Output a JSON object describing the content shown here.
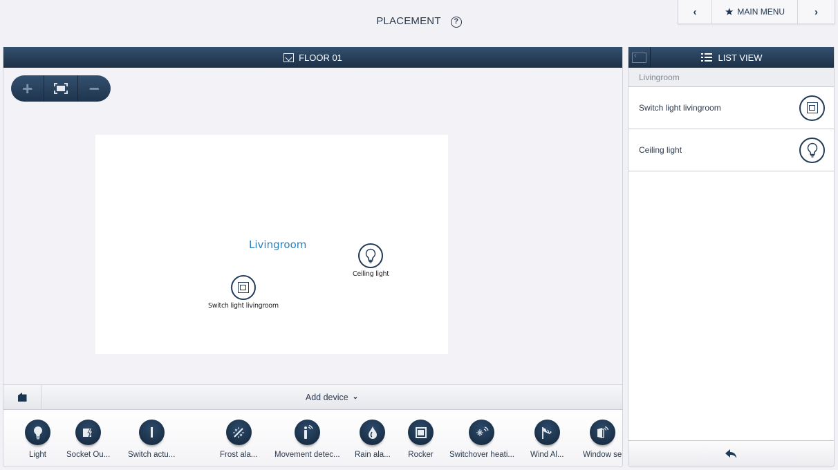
{
  "header": {
    "title": "PLACEMENT",
    "help_icon": "?",
    "nav": {
      "prev_icon": "‹",
      "main_menu_label": "MAIN MENU",
      "main_menu_icon": "★",
      "next_icon": "›"
    }
  },
  "floor_panel": {
    "title": "FLOOR 01",
    "zoom_controls": {
      "zoom_in": "+",
      "zoom_out": "−"
    },
    "room": {
      "name": "Livingroom",
      "devices": [
        {
          "label": "Switch light livingroom",
          "icon": "rocker-switch-icon"
        },
        {
          "label": "Ceiling light",
          "icon": "lightbulb-icon"
        }
      ]
    },
    "add_device_label": "Add device",
    "add_device_chevron": "⌄",
    "device_palette": [
      {
        "label": "Light",
        "icon": "lightbulb-icon"
      },
      {
        "label": "Socket Ou...",
        "icon": "socket-outlet-icon"
      },
      {
        "label": "Switch actu...",
        "icon": "switch-actuator-icon"
      },
      {
        "label": "Frost ala...",
        "icon": "frost-alarm-icon"
      },
      {
        "label": "Movement detec...",
        "icon": "movement-detector-icon"
      },
      {
        "label": "Rain ala...",
        "icon": "rain-alarm-icon"
      },
      {
        "label": "Rocker",
        "icon": "rocker-icon"
      },
      {
        "label": "Switchover heati...",
        "icon": "switchover-heating-icon"
      },
      {
        "label": "Wind Al...",
        "icon": "wind-alarm-icon"
      },
      {
        "label": "Window se",
        "icon": "window-sensor-icon"
      }
    ]
  },
  "list_panel": {
    "title": "LIST VIEW",
    "group": "Livingroom",
    "items": [
      {
        "label": "Switch light livingroom",
        "icon": "rocker-switch-icon"
      },
      {
        "label": "Ceiling light",
        "icon": "lightbulb-icon"
      }
    ],
    "footer_icon": "back-arrow-icon"
  },
  "colors": {
    "header_bg": "#1d3047",
    "accent_room_label": "#2a7fb8",
    "background": "#f2f2f6"
  }
}
